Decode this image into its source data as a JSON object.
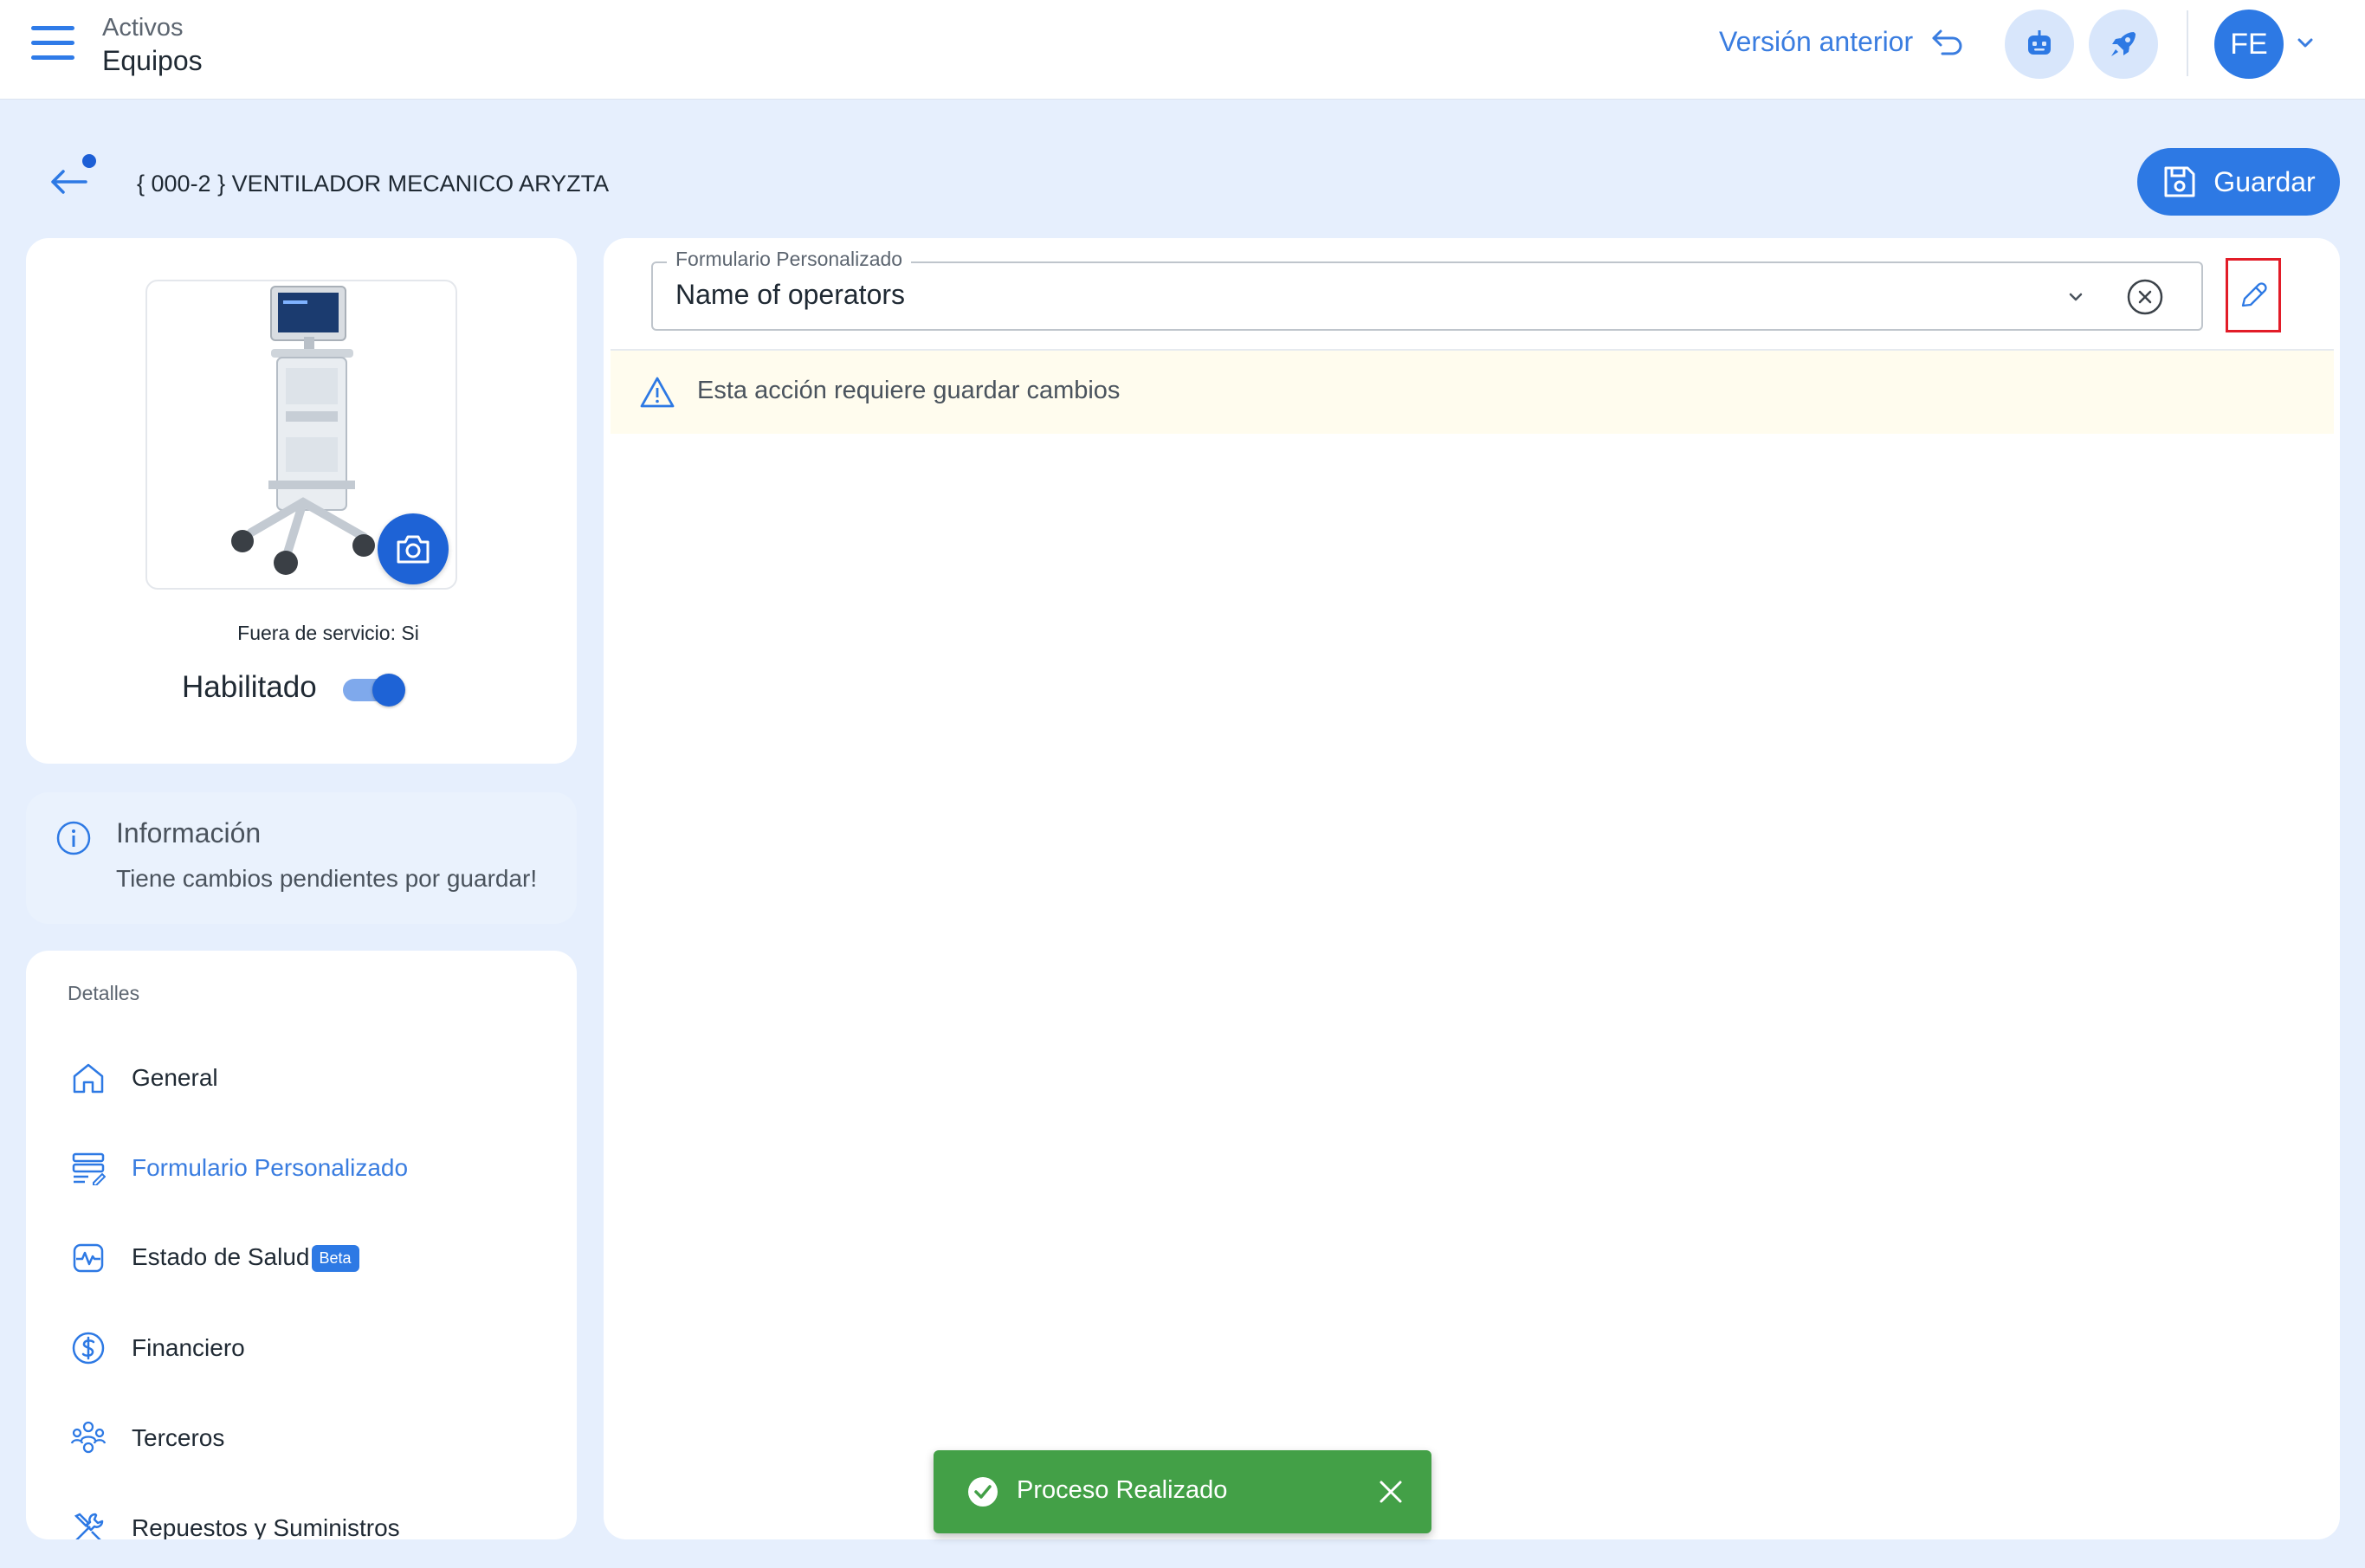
{
  "topbar": {
    "breadcrumb_section": "Activos",
    "breadcrumb_page": "Equipos",
    "previous_version_label": "Versión anterior",
    "avatar_initials": "FE"
  },
  "asset": {
    "title": "{ 000-2 } VENTILADOR MECANICO ARYZTA",
    "save_label": "Guardar",
    "out_of_service": "Fuera de servicio: Si",
    "enabled_label": "Habilitado",
    "enabled": true
  },
  "info_panel": {
    "title": "Información",
    "message": "Tiene cambios pendientes por guardar!"
  },
  "details": {
    "heading": "Detalles",
    "items": [
      {
        "label": "General",
        "icon": "home-icon",
        "active": false
      },
      {
        "label": "Formulario Personalizado",
        "icon": "form-icon",
        "active": true
      },
      {
        "label": "Estado de Salud",
        "icon": "health-icon",
        "active": false,
        "badge": "Beta"
      },
      {
        "label": "Financiero",
        "icon": "dollar-icon",
        "active": false
      },
      {
        "label": "Terceros",
        "icon": "people-icon",
        "active": false
      },
      {
        "label": "Repuestos y Suministros",
        "icon": "tools-icon",
        "active": false
      }
    ]
  },
  "form": {
    "select_label": "Formulario Personalizado",
    "selected_value": "Name of operators",
    "warning": "Esta acción requiere guardar cambios"
  },
  "toast": {
    "message": "Proceso Realizado"
  },
  "colors": {
    "primary": "#2d79e4",
    "page_bg": "#e6effd",
    "success": "#43a047",
    "highlight_border": "#e21c28",
    "warning_bg": "#fffcee"
  }
}
